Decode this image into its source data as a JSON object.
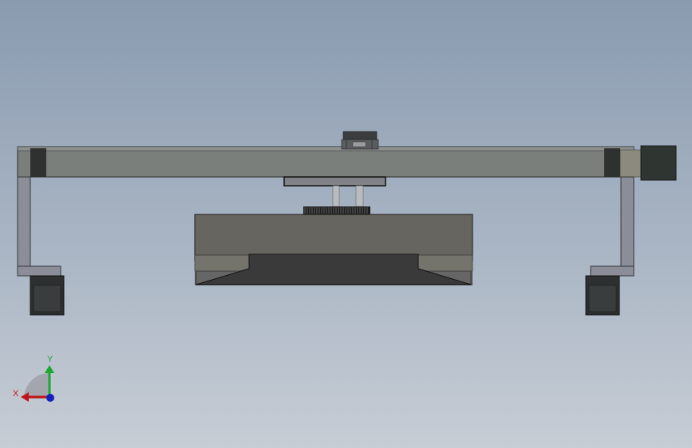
{
  "viewport": {
    "background_top": "#8a9bb0",
    "background_bottom": "#c7cdd5"
  },
  "model": {
    "frame_color": "#7a7d7b",
    "frame_dark": "#2b2e2d",
    "leg_color": "#8c8f98",
    "motor_color": "#2e3431",
    "box_color": "#66655f",
    "hopper_color": "#3a3a3a",
    "gear_color": "#1e1e1e",
    "shaft_color": "#b9bcbf"
  },
  "triad": {
    "x_label": "X",
    "y_label": "Y",
    "x_color": "#c0141a",
    "y_color": "#1aa830",
    "z_color": "#1420c0"
  }
}
